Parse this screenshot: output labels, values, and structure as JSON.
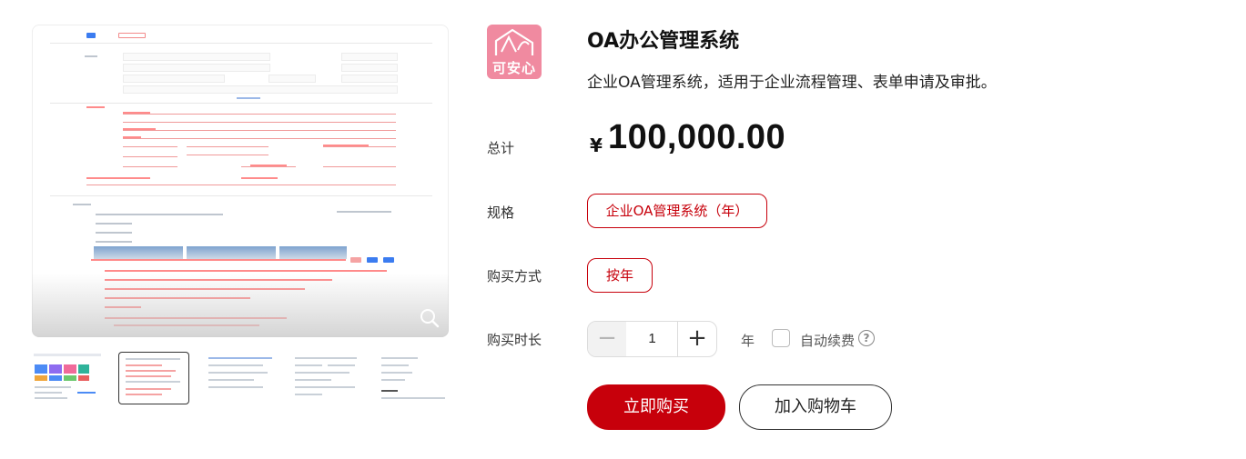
{
  "product": {
    "logo_text": "可安心",
    "title": "OA办公管理系统",
    "description": "企业OA管理系统，适用于企业流程管理、表单申请及审批。"
  },
  "price": {
    "label": "总计",
    "currency_symbol": "¥",
    "amount": "100,000.00"
  },
  "spec": {
    "label": "规格",
    "selected": "企业OA管理系统（年）"
  },
  "purchase_mode": {
    "label": "购买方式",
    "selected": "按年"
  },
  "duration": {
    "label": "购买时长",
    "minus": "−",
    "value": "1",
    "plus": "+",
    "unit": "年",
    "auto_renew_label": "自动续费",
    "help": "?"
  },
  "actions": {
    "buy_now": "立即购买",
    "add_to_cart": "加入购物车"
  },
  "gallery": {
    "thumbnail_count": 5,
    "selected_thumbnail": 2
  },
  "colors": {
    "accent": "#c7000b",
    "logo_bg": "#f08aa0"
  }
}
